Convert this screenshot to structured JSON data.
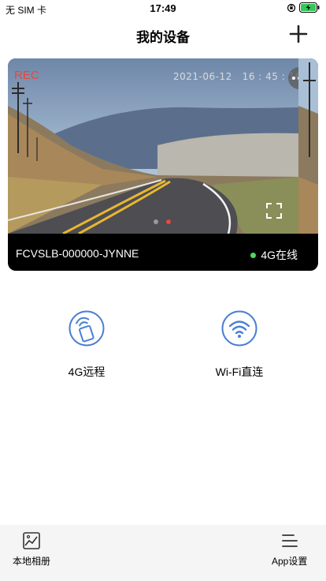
{
  "status_bar": {
    "carrier": "无 SIM 卡",
    "time": "17:49"
  },
  "nav": {
    "title": "我的设备",
    "add_icon": "plus-icon"
  },
  "device": {
    "rec_label": "REC",
    "timestamp": "2021-06-12   16 : 45 : 16",
    "name": "FCVSLB-000000-JYNNE",
    "status": "4G在线",
    "status_color": "#4cd964",
    "accent_color": "#e8473f",
    "carousel": {
      "pages": 2,
      "active": 2
    }
  },
  "modes": [
    {
      "label": "4G远程",
      "icon": "remote-4g-icon"
    },
    {
      "label": "Wi-Fi直连",
      "icon": "wifi-icon"
    }
  ],
  "colors": {
    "icon_blue": "#4a7fd4"
  },
  "tabs": [
    {
      "label": "本地相册",
      "icon": "photo-album-icon"
    },
    {
      "label": "App设置",
      "icon": "menu-icon"
    }
  ]
}
